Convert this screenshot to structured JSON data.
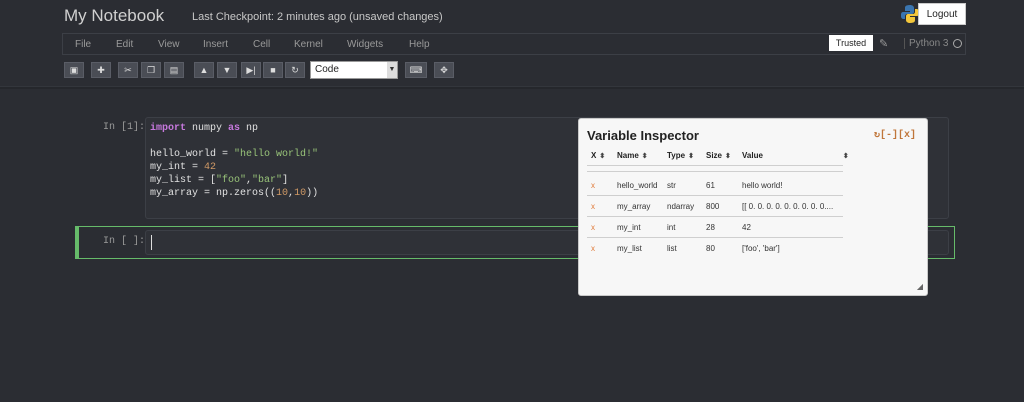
{
  "header": {
    "title": "My Notebook",
    "checkpoint": "Last Checkpoint: 2 minutes ago (unsaved changes)",
    "logout_label": "Logout"
  },
  "menu": {
    "items": [
      "File",
      "Edit",
      "View",
      "Insert",
      "Cell",
      "Kernel",
      "Widgets",
      "Help"
    ]
  },
  "status": {
    "trusted_label": "Trusted",
    "kernel_name": "Python 3"
  },
  "toolbar": {
    "cell_type": "Code",
    "buttons": [
      "save-icon",
      "plus-icon",
      "cut-icon",
      "copy-icon",
      "paste-icon",
      "arrow-up-icon",
      "arrow-down-icon",
      "run-icon",
      "stop-icon",
      "restart-icon",
      "keyboard-icon",
      "move-icon"
    ]
  },
  "cells": [
    {
      "prompt": "In [1]:"
    },
    {
      "prompt": "In [ ]:"
    }
  ],
  "inspector": {
    "title": "Variable Inspector",
    "controls": "↻[-][x]",
    "columns": [
      "X",
      "Name",
      "Type",
      "Size",
      "Value"
    ],
    "rows": [
      {
        "x": "x",
        "name": "hello_world",
        "type": "str",
        "size": "61",
        "value": "hello world!"
      },
      {
        "x": "x",
        "name": "my_array",
        "type": "ndarray",
        "size": "800",
        "value": "[[ 0. 0. 0. 0. 0. 0. 0. 0. 0...."
      },
      {
        "x": "x",
        "name": "my_int",
        "type": "int",
        "size": "28",
        "value": "42"
      },
      {
        "x": "x",
        "name": "my_list",
        "type": "list",
        "size": "80",
        "value": "['foo', 'bar']"
      }
    ]
  },
  "colors": {
    "background": "#2b2d33",
    "accent": "#66bb6a",
    "inspector_bg": "#f7f7f7",
    "remove_x": "#e07a38"
  }
}
